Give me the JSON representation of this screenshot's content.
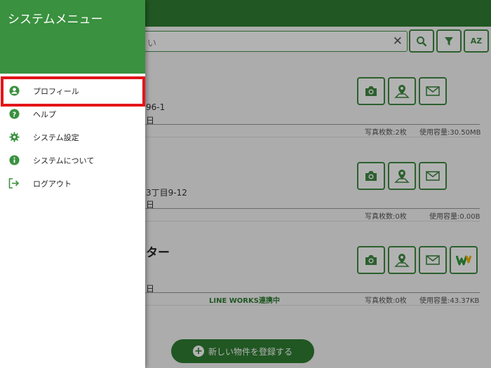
{
  "drawer": {
    "title": "システムメニュー",
    "items": [
      {
        "label": "プロフィール",
        "icon": "account-circle-icon"
      },
      {
        "label": "ヘルプ",
        "icon": "help-circle-icon"
      },
      {
        "label": "システム設定",
        "icon": "gear-icon"
      },
      {
        "label": "システムについて",
        "icon": "info-circle-icon"
      },
      {
        "label": "ログアウト",
        "icon": "logout-icon"
      }
    ]
  },
  "search": {
    "placeholder_fragment": "い",
    "sort_label": "AZ"
  },
  "cards": [
    {
      "title": "",
      "address": "96-1",
      "date": "日",
      "photo_count": "写真枚数:2枚",
      "usage": "使用容量:30.50MB",
      "lineworks": ""
    },
    {
      "title": "",
      "address": "3丁目9-12",
      "date": "日",
      "photo_count": "写真枚数:0枚",
      "usage": "使用容量:0.00B",
      "lineworks": ""
    },
    {
      "title": "ター",
      "address": "",
      "date": "日",
      "photo_count": "写真枚数:0枚",
      "usage": "使用容量:43.37KB",
      "lineworks": "LINE WORKS連携中"
    }
  ],
  "fab": {
    "label": "新しい物件を登録する"
  },
  "colors": {
    "brand": "#2e7d32",
    "drawer_header": "#3a913f",
    "highlight": "#e3151a"
  }
}
